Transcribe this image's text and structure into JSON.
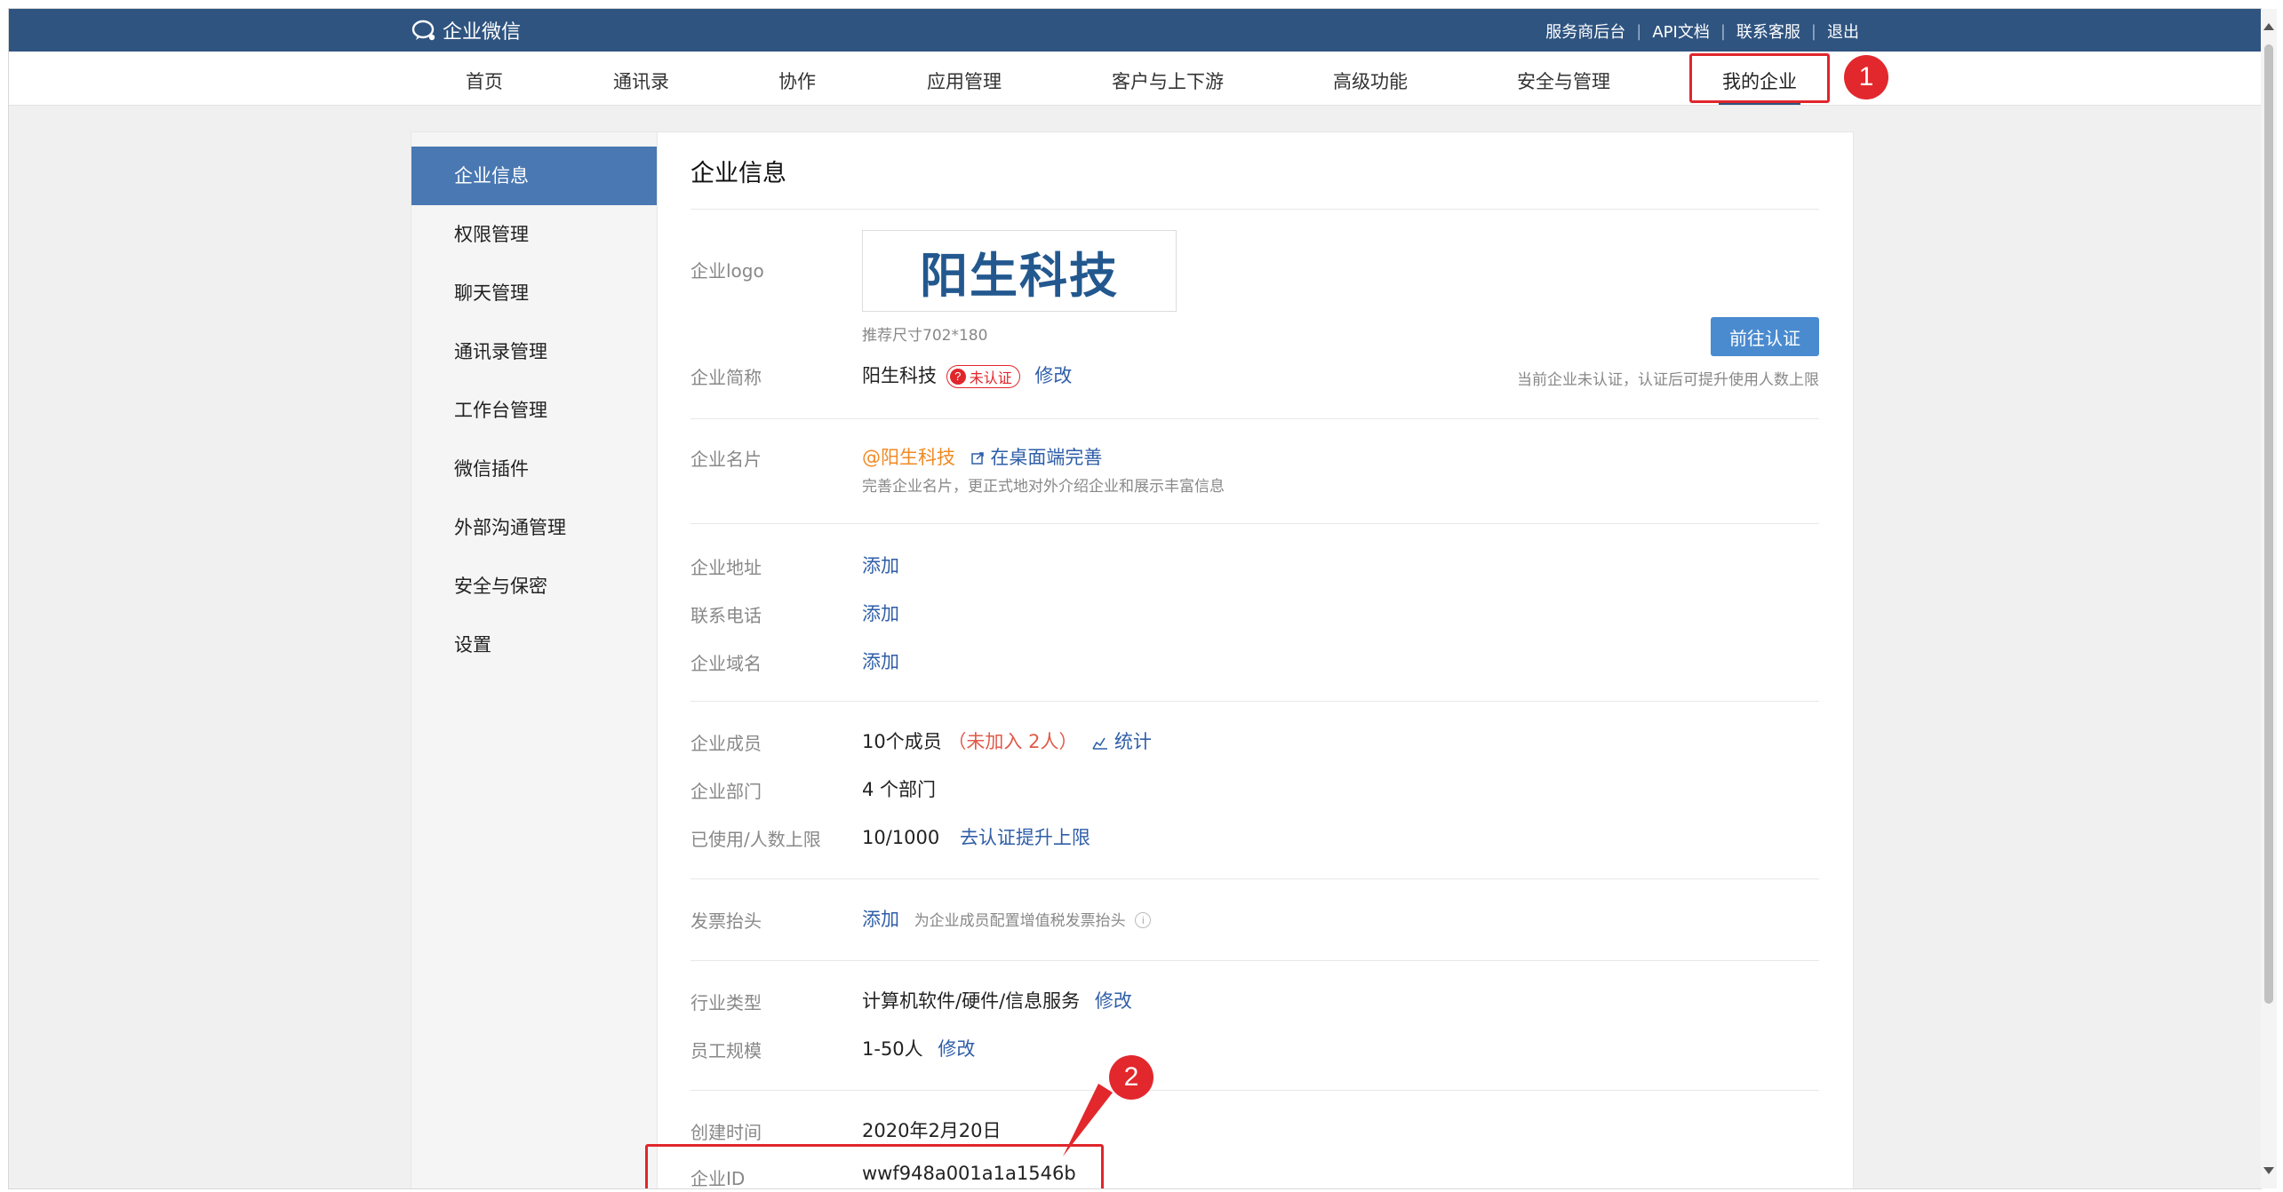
{
  "topbar": {
    "brand": "企业微信",
    "links": [
      "服务商后台",
      "API文档",
      "联系客服",
      "退出"
    ]
  },
  "nav": {
    "items": [
      "首页",
      "通讯录",
      "协作",
      "应用管理",
      "客户与上下游",
      "高级功能",
      "安全与管理",
      "我的企业"
    ],
    "active": "我的企业"
  },
  "annotations": {
    "marker1": "1",
    "marker2": "2"
  },
  "sidebar": {
    "items": [
      "企业信息",
      "权限管理",
      "聊天管理",
      "通讯录管理",
      "工作台管理",
      "微信插件",
      "外部沟通管理",
      "安全与保密",
      "设置"
    ],
    "active": "企业信息"
  },
  "main": {
    "title": "企业信息",
    "logo_label": "企业logo",
    "logo_text": "阳生科技",
    "logo_hint": "推荐尺寸702*180",
    "verify_button": "前往认证",
    "verify_hint": "当前企业未认证，认证后可提升使用人数上限",
    "short_name_label": "企业简称",
    "short_name": "阳生科技",
    "unverified_badge": "未认证",
    "edit": "修改",
    "card_label": "企业名片",
    "card_name": "@阳生科技",
    "card_link": "在桌面端完善",
    "card_hint": "完善企业名片，更正式地对外介绍企业和展示丰富信息",
    "address_label": "企业地址",
    "phone_label": "联系电话",
    "domain_label": "企业域名",
    "add": "添加",
    "members_label": "企业成员",
    "members_value": "10个成员",
    "members_not_joined": "（未加入 2人）",
    "stats": "统计",
    "dept_label": "企业部门",
    "dept_value": "4 个部门",
    "limit_label": "已使用/人数上限",
    "limit_value": "10/1000",
    "limit_link": "去认证提升上限",
    "invoice_label": "发票抬头",
    "invoice_hint": "为企业成员配置增值税发票抬头",
    "industry_label": "行业类型",
    "industry_value": "计算机软件/硬件/信息服务",
    "scale_label": "员工规模",
    "scale_value": "1-50人",
    "created_label": "创建时间",
    "created_value": "2020年2月20日",
    "corp_id_label": "企业ID",
    "corp_id_value": "wwf948a001a1a1546b"
  },
  "colors": {
    "topbar": "#2f5480",
    "accent": "#2f5ea8",
    "sidebar_active": "#4a78b2",
    "annotation": "#e0262b",
    "warning": "#f08a24"
  }
}
